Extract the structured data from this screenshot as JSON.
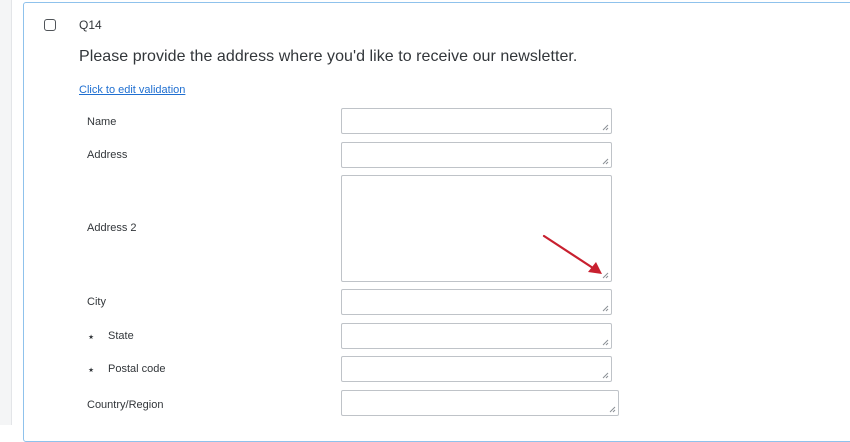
{
  "question": {
    "id": "Q14",
    "text": "Please provide the address where you'd like to receive our newsletter.",
    "validation_link": "Click to edit validation"
  },
  "fields": [
    {
      "label": "Name",
      "required": false
    },
    {
      "label": "Address",
      "required": false
    },
    {
      "label": "Address 2",
      "required": false
    },
    {
      "label": "City",
      "required": false
    },
    {
      "label": "State",
      "required": true
    },
    {
      "label": "Postal code",
      "required": true
    },
    {
      "label": "Country/Region",
      "required": false
    }
  ],
  "required_marker": "⋆",
  "icons": {
    "checkbox": "checkbox-icon",
    "resize": "resize-grip-icon",
    "annotation": "arrow-icon"
  },
  "colors": {
    "card_border": "#8fc2ec",
    "link": "#1f6fd1",
    "annotation_arrow": "#c8202f",
    "input_border": "#bfc3c8"
  }
}
